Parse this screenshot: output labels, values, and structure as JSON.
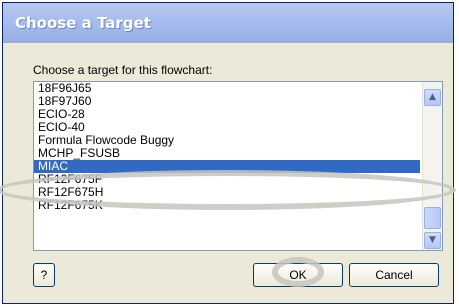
{
  "dialog": {
    "title": "Choose a Target",
    "prompt": "Choose a target for this flowchart:"
  },
  "list": {
    "items": [
      "18F96J65",
      "18F97J60",
      "ECIO-28",
      "ECIO-40",
      "Formula Flowcode Buggy",
      "MCHP_FSUSB",
      "MIAC",
      "RF12F675F",
      "RF12F675H",
      "RF12F675K"
    ],
    "selected_index": 6
  },
  "buttons": {
    "help": "?",
    "ok": "OK",
    "cancel": "Cancel"
  },
  "scrollbar": {
    "up_glyph": "▲",
    "down_glyph": "▼"
  },
  "colors": {
    "selection": "#316ac5",
    "title_bar": "#a7bdee",
    "annotation": "#c6c6bc"
  }
}
